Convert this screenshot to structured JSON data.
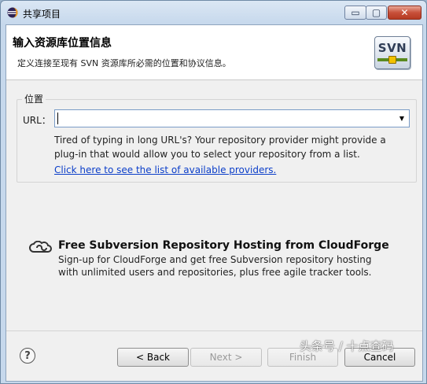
{
  "window": {
    "title": "共享项目",
    "minimize_glyph": "▭",
    "maximize_glyph": "▢",
    "close_glyph": "✕"
  },
  "banner": {
    "title": "输入资源库位置信息",
    "description": "定义连接至现有 SVN 资源库所必需的位置和协议信息。",
    "logo_text": "SVN"
  },
  "location": {
    "group_label": "位置",
    "url_label": "URL：",
    "url_value": "",
    "hint": "Tired of typing in long URL's?  Your repository provider might provide a plug-in that would allow you to select your repository from a list.",
    "providers_link": "Click here to see the list of available providers."
  },
  "cloudforge": {
    "title": "Free Subversion Repository Hosting from CloudForge",
    "description_line1": "Sign-up for CloudForge and get free Subversion repository hosting",
    "description_line2": "with unlimited users and repositories, plus free agile tracker tools."
  },
  "footer": {
    "help_glyph": "?",
    "back_label": "< Back",
    "next_label": "Next >",
    "finish_label": "Finish",
    "cancel_label": "Cancel"
  },
  "watermark": "头条号 / 十点查码",
  "icons": {
    "app": "eclipse-icon",
    "logo": "svn-logo-icon",
    "cloudforge": "cloudforge-icon",
    "help": "help-icon",
    "dropdown": "chevron-down-icon"
  },
  "colors": {
    "link": "#0b3ec9",
    "titlebar": "#c6d8ec",
    "close_button": "#c8503a"
  }
}
